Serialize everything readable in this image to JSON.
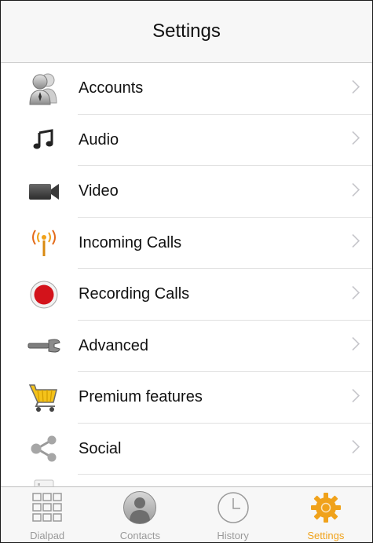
{
  "header": {
    "title": "Settings"
  },
  "settings_items": [
    {
      "label": "Accounts",
      "icon": "accounts-icon"
    },
    {
      "label": "Audio",
      "icon": "music-note-icon"
    },
    {
      "label": "Video",
      "icon": "video-camera-icon"
    },
    {
      "label": "Incoming Calls",
      "icon": "antenna-icon"
    },
    {
      "label": "Recording Calls",
      "icon": "record-icon"
    },
    {
      "label": "Advanced",
      "icon": "wrench-icon"
    },
    {
      "label": "Premium features",
      "icon": "shopping-cart-icon"
    },
    {
      "label": "Social",
      "icon": "share-icon"
    }
  ],
  "tabbar": {
    "tabs": [
      {
        "label": "Dialpad",
        "icon": "dialpad-icon",
        "active": false
      },
      {
        "label": "Contacts",
        "icon": "contact-person-icon",
        "active": false
      },
      {
        "label": "History",
        "icon": "clock-icon",
        "active": false
      },
      {
        "label": "Settings",
        "icon": "gear-icon",
        "active": true
      }
    ]
  },
  "colors": {
    "accent": "#f0a21b",
    "record": "#d3131b",
    "chevron": "#c7c7cc"
  }
}
